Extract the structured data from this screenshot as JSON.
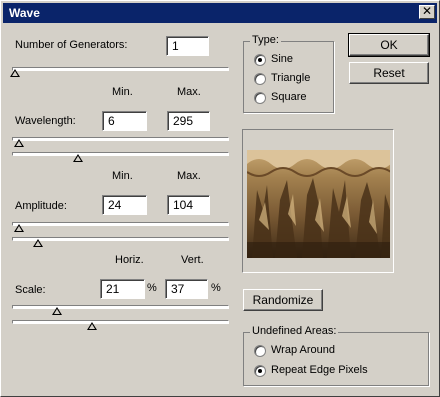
{
  "window": {
    "title": "Wave",
    "close_glyph": "✕"
  },
  "generators": {
    "label": "Number of Generators:",
    "value": "1"
  },
  "wavelength": {
    "col_min": "Min.",
    "col_max": "Max.",
    "label": "Wavelength:",
    "min": "6",
    "max": "295"
  },
  "amplitude": {
    "col_min": "Min.",
    "col_max": "Max.",
    "label": "Amplitude:",
    "min": "24",
    "max": "104"
  },
  "scale": {
    "col_horiz": "Horiz.",
    "col_vert": "Vert.",
    "label": "Scale:",
    "horiz": "21",
    "vert": "37",
    "unit": "%"
  },
  "type": {
    "legend": "Type:",
    "options": [
      "Sine",
      "Triangle",
      "Square"
    ],
    "selected": "Sine"
  },
  "buttons": {
    "ok": "OK",
    "reset": "Reset",
    "randomize": "Randomize"
  },
  "undefined_areas": {
    "legend": "Undefined Areas:",
    "options": [
      "Wrap Around",
      "Repeat Edge Pixels"
    ],
    "selected": "Repeat Edge Pixels"
  },
  "sliders": {
    "generators": 0.0,
    "wavelength_min": 0.02,
    "wavelength_max": 0.3,
    "amplitude_min": 0.02,
    "amplitude_max": 0.11,
    "scale_horiz": 0.2,
    "scale_vert": 0.37
  },
  "colors": {
    "titlebar": "#0a246a",
    "dialog_face": "#d4d0c8",
    "preview_tone": "#9a7a4c"
  },
  "icons": {
    "close": "close-icon",
    "radio_selected": "radio-dot-icon"
  }
}
